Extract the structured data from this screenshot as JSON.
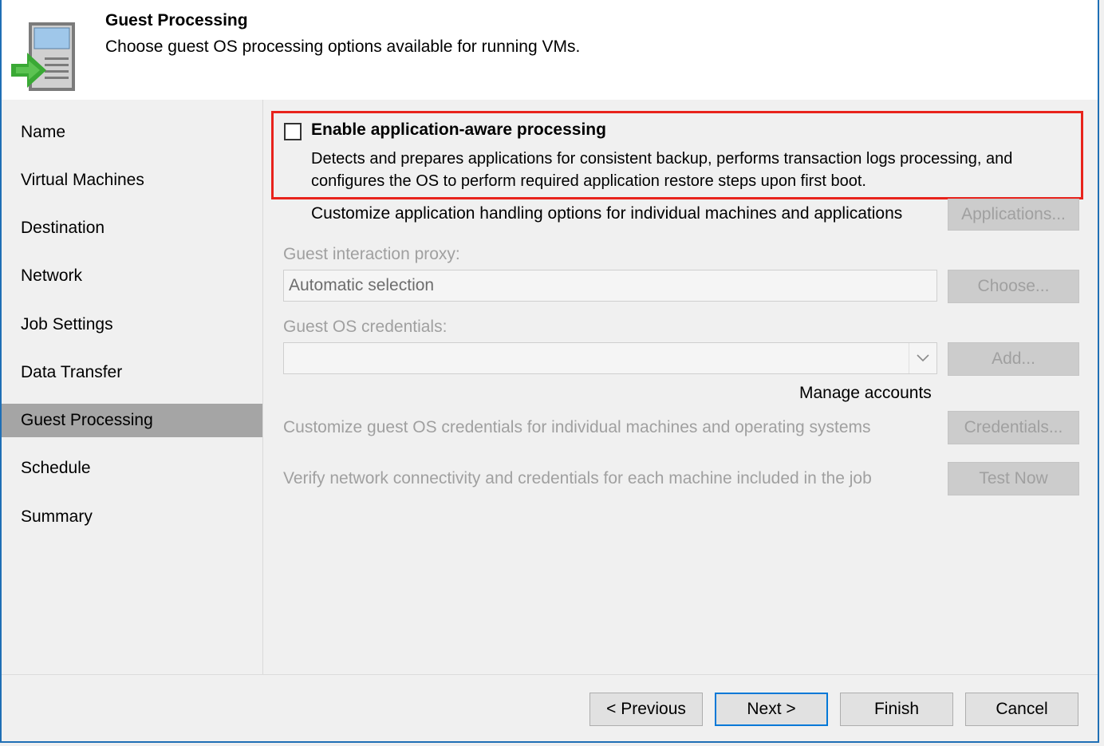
{
  "header": {
    "title": "Guest Processing",
    "subtitle": "Choose guest OS processing options available for running VMs.",
    "icon": "server-arrow-icon"
  },
  "sidebar": {
    "items": [
      {
        "label": "Name"
      },
      {
        "label": "Virtual Machines"
      },
      {
        "label": "Destination"
      },
      {
        "label": "Network"
      },
      {
        "label": "Job Settings"
      },
      {
        "label": "Data Transfer"
      },
      {
        "label": "Guest Processing",
        "active": true
      },
      {
        "label": "Schedule"
      },
      {
        "label": "Summary"
      }
    ]
  },
  "main": {
    "enable_checkbox": {
      "label": "Enable application-aware processing",
      "checked": false
    },
    "enable_description": "Detects and prepares applications for consistent backup, performs transaction logs processing, and configures the OS to perform required application restore steps upon first boot.",
    "customize_apps_text": "Customize application handling options for individual machines and applications",
    "applications_button": "Applications...",
    "proxy_label": "Guest interaction proxy:",
    "proxy_value": "Automatic selection",
    "choose_button": "Choose...",
    "credentials_label": "Guest OS credentials:",
    "credentials_value": "",
    "add_button": "Add...",
    "manage_accounts_link": "Manage accounts",
    "customize_creds_text": "Customize guest OS credentials for individual machines and operating systems",
    "credentials_button": "Credentials...",
    "verify_text": "Verify network connectivity and credentials for each machine included in the job",
    "test_now_button": "Test Now"
  },
  "footer": {
    "previous": "< Previous",
    "next": "Next >",
    "finish": "Finish",
    "cancel": "Cancel"
  },
  "colors": {
    "highlight": "#e8231c",
    "active_nav": "#a5a5a5",
    "window_border": "#1f6fb5",
    "primary_border": "#0078d7"
  }
}
